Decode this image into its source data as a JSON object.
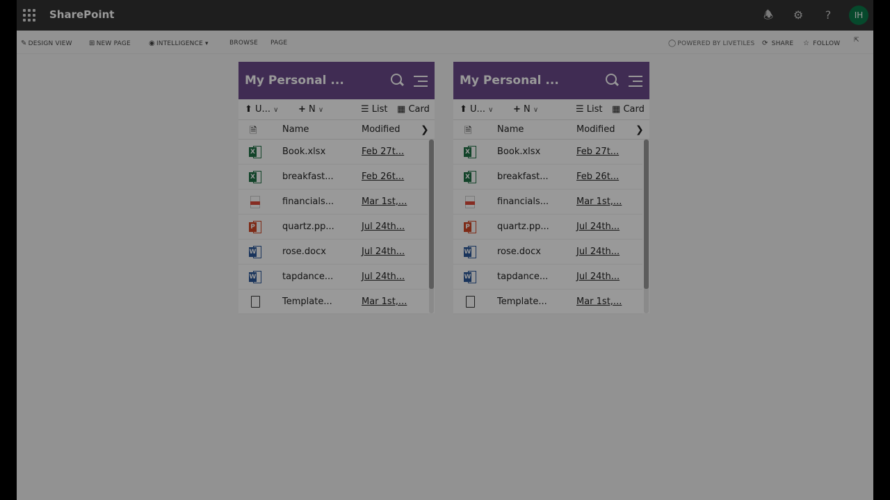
{
  "suitebar": {
    "app_title": "SharePoint",
    "avatar_initials": "IH",
    "icons": [
      "waffle-icon",
      "bell-icon",
      "gear-icon",
      "help-icon"
    ]
  },
  "commandbar": {
    "design_view": "DESIGN VIEW",
    "new_page": "NEW PAGE",
    "intelligence": "INTELLIGENCE",
    "browse": "BROWSE",
    "page": "PAGE",
    "powered_by": "POWERED BY LIVETILES",
    "share": "SHARE",
    "follow": "FOLLOW"
  },
  "panels": [
    {
      "title": "My Personal ...",
      "upload_label": "U...",
      "new_label": "N",
      "list_label": "List",
      "card_label": "Card",
      "col_name": "Name",
      "col_modified": "Modified",
      "files": [
        {
          "name": "Book.xlsx",
          "modified": "Feb 27t...",
          "type": "excel"
        },
        {
          "name": "breakfast...",
          "modified": "Feb 26t...",
          "type": "excel"
        },
        {
          "name": "financials...",
          "modified": "Mar 1st,...",
          "type": "pdf"
        },
        {
          "name": "quartz.pp...",
          "modified": "Jul 24th...",
          "type": "powerpoint"
        },
        {
          "name": "rose.docx",
          "modified": "Jul 24th...",
          "type": "word"
        },
        {
          "name": "tapdance...",
          "modified": "Jul 24th...",
          "type": "word"
        },
        {
          "name": "Template...",
          "modified": "Mar 1st,...",
          "type": "generic"
        }
      ]
    },
    {
      "title": "My Personal ...",
      "upload_label": "U...",
      "new_label": "N",
      "list_label": "List",
      "card_label": "Card",
      "col_name": "Name",
      "col_modified": "Modified",
      "files": [
        {
          "name": "Book.xlsx",
          "modified": "Feb 27t...",
          "type": "excel"
        },
        {
          "name": "breakfast...",
          "modified": "Feb 26t...",
          "type": "excel"
        },
        {
          "name": "financials...",
          "modified": "Mar 1st,...",
          "type": "pdf"
        },
        {
          "name": "quartz.pp...",
          "modified": "Jul 24th...",
          "type": "powerpoint"
        },
        {
          "name": "rose.docx",
          "modified": "Jul 24th...",
          "type": "word"
        },
        {
          "name": "tapdance...",
          "modified": "Jul 24th...",
          "type": "word"
        },
        {
          "name": "Template...",
          "modified": "Mar 1st,...",
          "type": "generic"
        }
      ]
    }
  ],
  "colors": {
    "suitebar": "#333333",
    "panel_header": "#6b4a8a",
    "excel": "#1e7145",
    "word": "#2b579a",
    "powerpoint": "#d24726",
    "pdf": "#e04a3a",
    "avatar": "#0a7a4a"
  }
}
